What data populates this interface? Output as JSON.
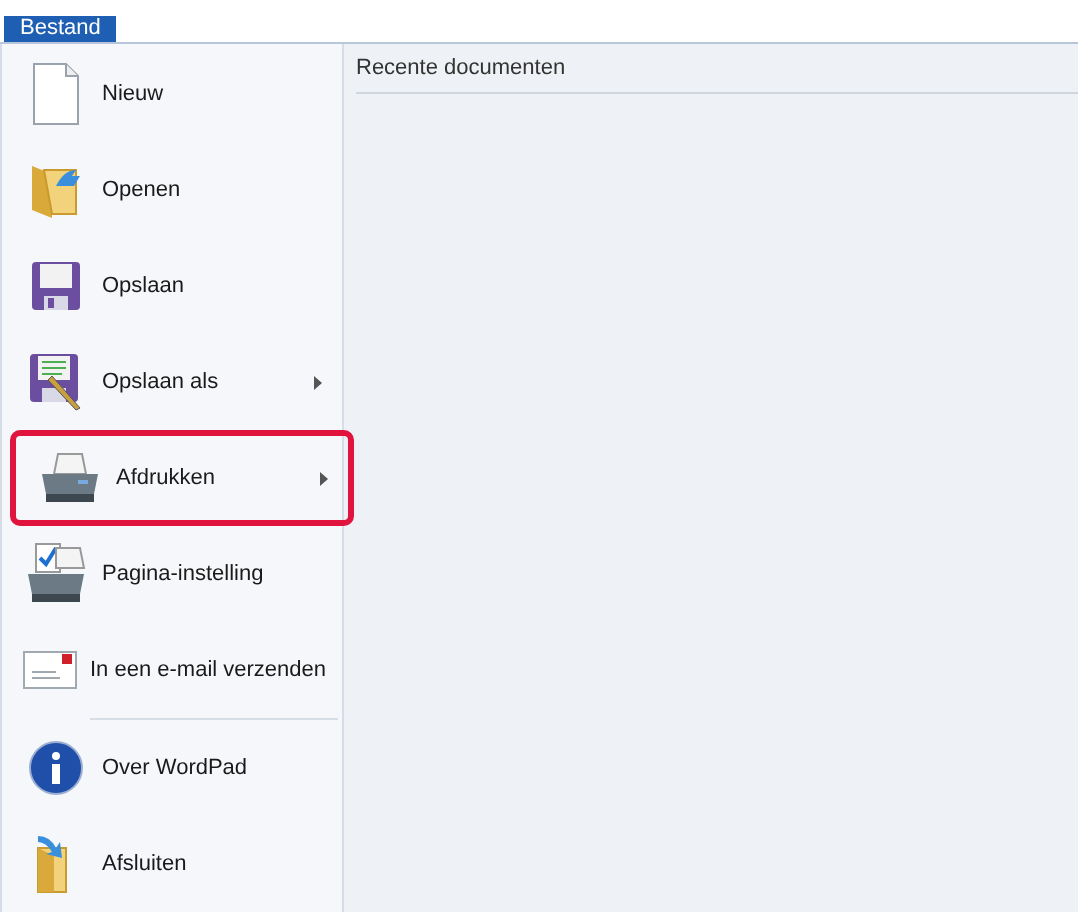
{
  "tab": {
    "label": "Bestand"
  },
  "menu": [
    {
      "kind": "new",
      "label": "Nieuw",
      "submenu": false,
      "highlighted": false
    },
    {
      "kind": "open",
      "label": "Openen",
      "submenu": false,
      "highlighted": false
    },
    {
      "kind": "save",
      "label": "Opslaan",
      "submenu": false,
      "highlighted": false
    },
    {
      "kind": "saveas",
      "label": "Opslaan als",
      "submenu": true,
      "highlighted": false
    },
    {
      "kind": "print",
      "label": "Afdrukken",
      "submenu": true,
      "highlighted": true
    },
    {
      "kind": "pagesetup",
      "label": "Pagina-instelling",
      "submenu": false,
      "highlighted": false
    },
    {
      "kind": "email",
      "label": "In een e-mail verzenden",
      "submenu": false,
      "highlighted": false,
      "separator_after": true
    },
    {
      "kind": "about",
      "label": "Over WordPad",
      "submenu": false,
      "highlighted": false
    },
    {
      "kind": "exit",
      "label": "Afsluiten",
      "submenu": false,
      "highlighted": false
    }
  ],
  "recent": {
    "heading": "Recente documenten"
  }
}
